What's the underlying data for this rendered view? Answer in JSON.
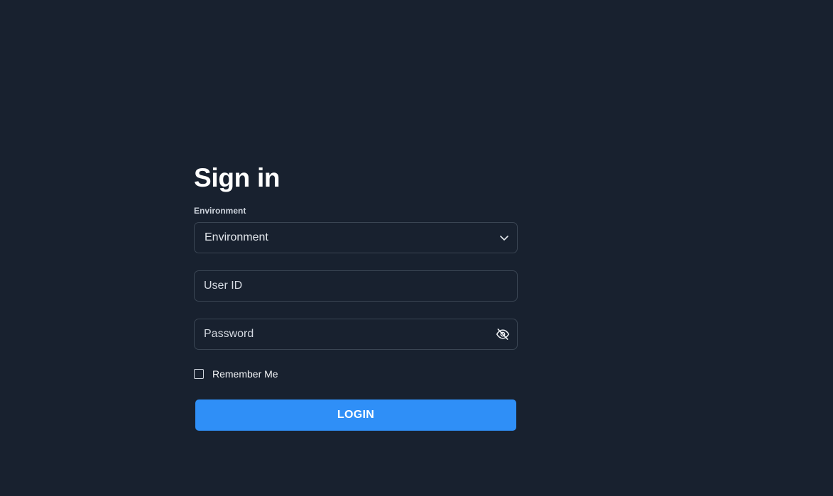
{
  "form": {
    "title": "Sign in",
    "environment_label": "Environment",
    "environment_select": {
      "value": "Environment",
      "icon": "chevron-down-icon"
    },
    "user_id": {
      "placeholder": "User ID",
      "value": ""
    },
    "password": {
      "placeholder": "Password",
      "value": "",
      "icon": "eye-off-icon"
    },
    "remember_me": {
      "label": "Remember Me",
      "checked": false
    },
    "login_button": "LOGIN"
  },
  "colors": {
    "background": "#18212f",
    "field_border": "#3a4553",
    "accent": "#2f8ff7",
    "text": "#ffffff"
  }
}
